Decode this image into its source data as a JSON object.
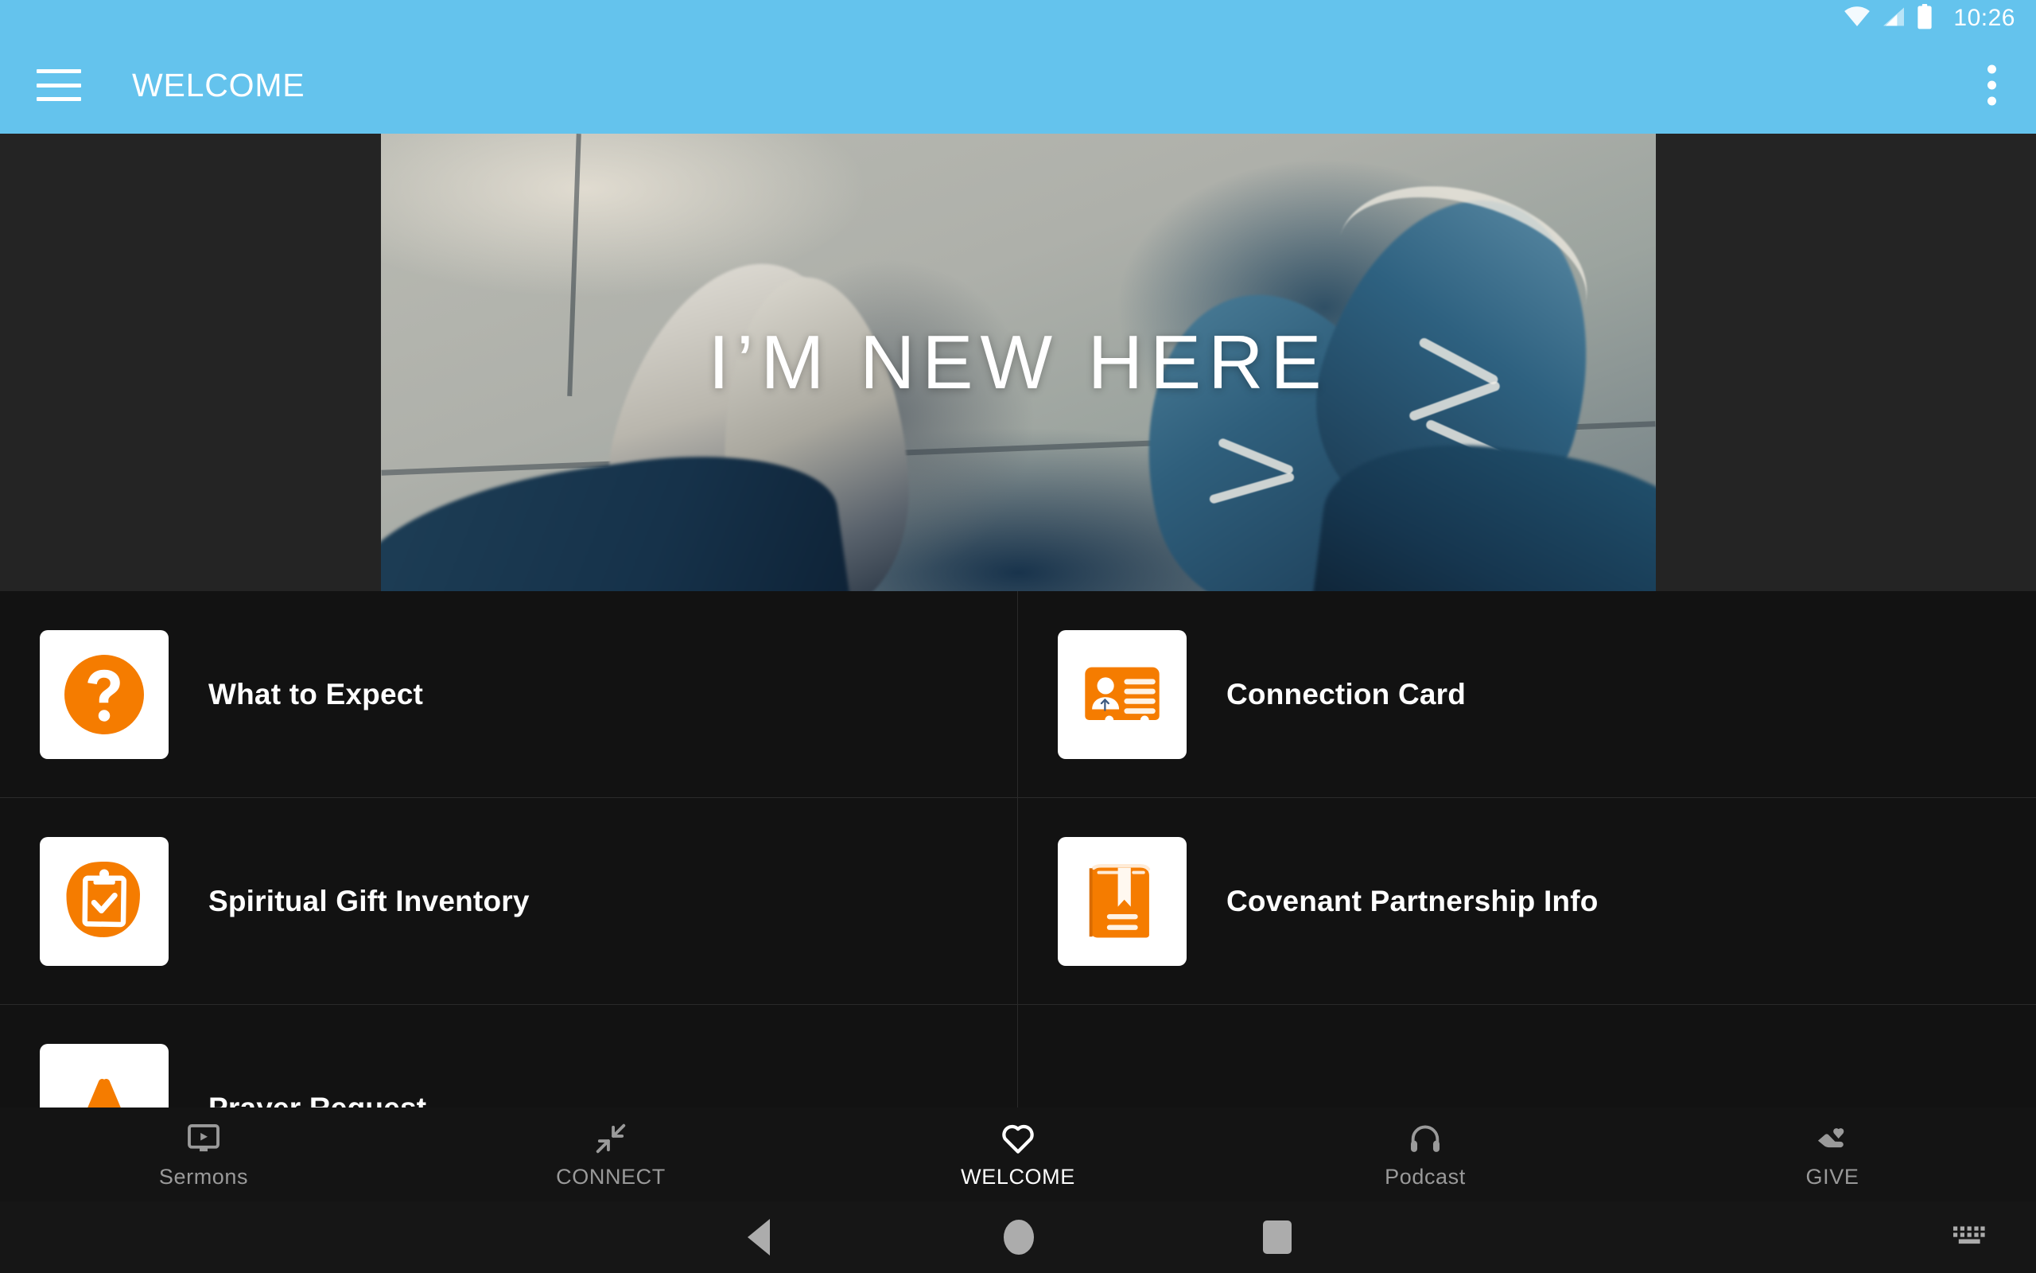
{
  "status_bar": {
    "time": "10:26",
    "icons": [
      "wifi-icon",
      "cellular-signal-icon",
      "battery-icon"
    ]
  },
  "app_bar": {
    "menu_icon": "hamburger-menu-icon",
    "title": "WELCOME",
    "overflow_icon": "overflow-menu-icon",
    "background_color": "#64C3ED"
  },
  "hero": {
    "caption": "I’M NEW HERE",
    "alt": "photo looking down at two pairs of shoes on concrete"
  },
  "list": {
    "accent_color": "#F57C00",
    "items": [
      {
        "label": "What to Expect",
        "icon": "question-mark-icon"
      },
      {
        "label": "Connection Card",
        "icon": "id-card-icon"
      },
      {
        "label": "Spiritual Gift Inventory",
        "icon": "clipboard-check-icon"
      },
      {
        "label": "Covenant Partnership Info",
        "icon": "book-bookmark-icon"
      },
      {
        "label": "Prayer Request",
        "icon": "praying-hands-icon"
      },
      {
        "label": "",
        "icon": ""
      }
    ]
  },
  "tab_bar": {
    "tabs": [
      {
        "label": "Sermons",
        "icon": "video-monitor-icon",
        "active": false
      },
      {
        "label": "CONNECT",
        "icon": "compress-arrows-icon",
        "active": false
      },
      {
        "label": "WELCOME",
        "icon": "heart-icon",
        "active": true
      },
      {
        "label": "Podcast",
        "icon": "headphones-icon",
        "active": false
      },
      {
        "label": "GIVE",
        "icon": "giving-hand-icon",
        "active": false
      }
    ]
  },
  "system_nav": {
    "back": "back-triangle-icon",
    "home": "home-circle-icon",
    "recents": "recents-square-icon",
    "keyboard": "keyboard-icon"
  }
}
